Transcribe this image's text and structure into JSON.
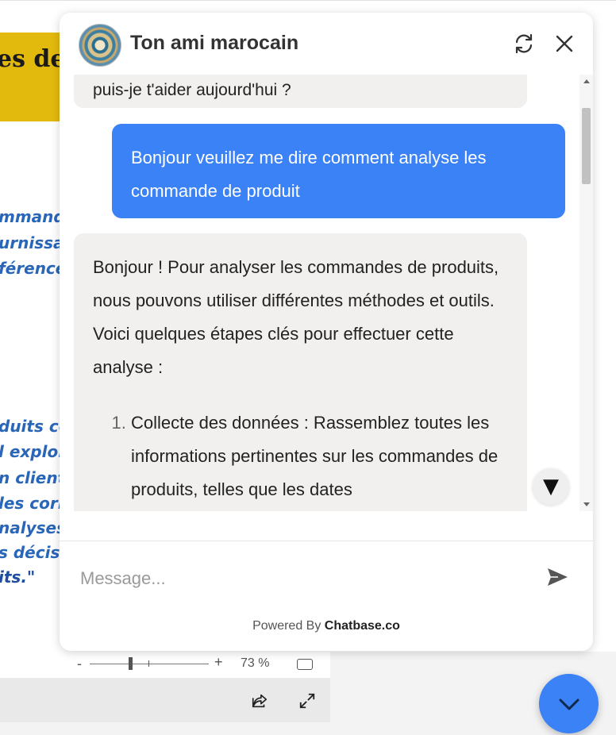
{
  "document": {
    "banner_text": "es de",
    "lines": [
      "mmande",
      "urnissar",
      "férences",
      "duits co",
      "l explor",
      "n client",
      "les corr",
      "nalyses",
      "s décisio",
      "its.\""
    ],
    "zoom": {
      "minus": "-",
      "plus": "+",
      "percent": "73 %"
    }
  },
  "chat": {
    "title": "Ton ami marocain",
    "messages": {
      "bot_top": "puis-je t'aider aujourd'hui ?",
      "user": "Bonjour veuillez me dire comment analyse les commande de produit",
      "bot_intro": "Bonjour ! Pour analyser les commandes de produits, nous pouvons utiliser différentes méthodes et outils. Voici quelques étapes clés pour effectuer cette analyse :",
      "bot_list": [
        "Collecte des données : Rassemblez toutes les informations pertinentes sur les commandes de produits, telles que les dates"
      ]
    },
    "scroll_down_glyph": "▼",
    "input_placeholder": "Message...",
    "powered_prefix": "Powered By ",
    "powered_brand": "Chatbase.co"
  },
  "colors": {
    "accent": "#3b82f6",
    "bot_bubble": "#f1f0ee",
    "banner": "#e2b90d"
  }
}
